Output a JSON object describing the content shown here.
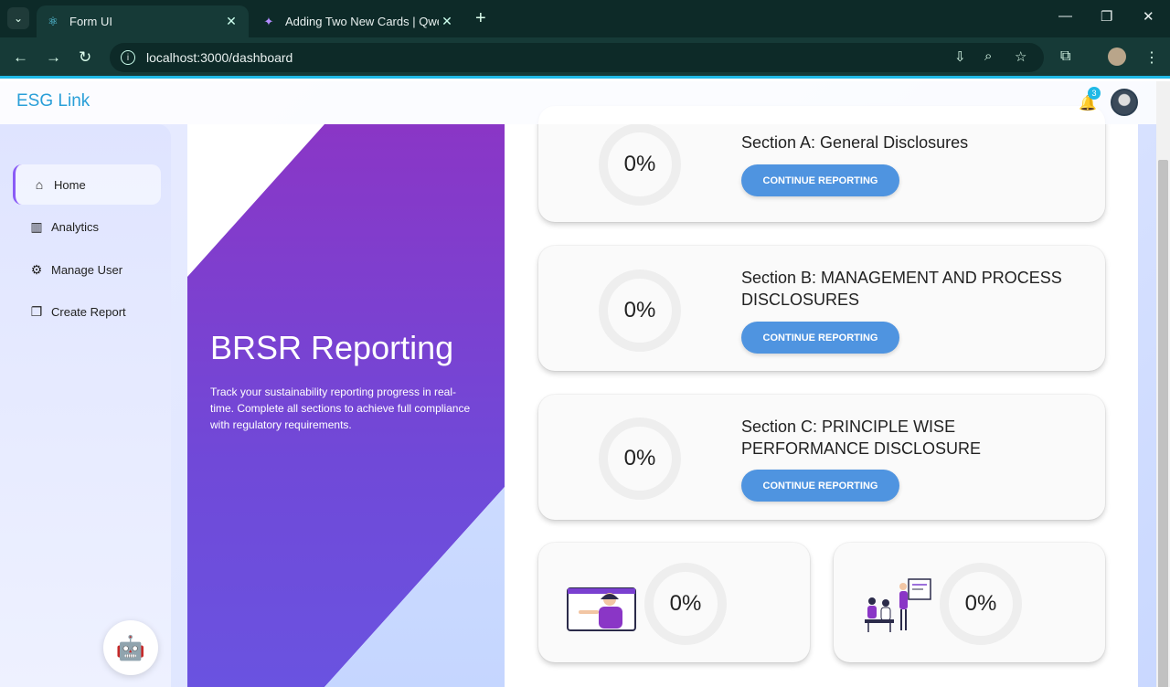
{
  "browser": {
    "tabs": [
      {
        "title": "Form UI",
        "icon": "react-icon",
        "active": true
      },
      {
        "title": "Adding Two New Cards | Qwen",
        "icon": "qwen-icon",
        "active": false
      }
    ],
    "url": "localhost:3000/dashboard"
  },
  "header": {
    "brand": "ESG Link",
    "notification_count": "3"
  },
  "sidebar": {
    "items": [
      {
        "label": "Home",
        "icon": "home-icon"
      },
      {
        "label": "Analytics",
        "icon": "analytics-icon"
      },
      {
        "label": "Manage User",
        "icon": "manage-user-icon"
      },
      {
        "label": "Create Report",
        "icon": "create-report-icon"
      }
    ]
  },
  "hero": {
    "title": "BRSR Reporting",
    "description": "Track your sustainability reporting progress in real-time. Complete all sections to achieve full compliance with regulatory requirements."
  },
  "sections": [
    {
      "title": "Section A: General Disclosures",
      "progress": "0%",
      "button": "CONTINUE REPORTING"
    },
    {
      "title": "Section B: MANAGEMENT AND PROCESS DISCLOSURES",
      "progress": "0%",
      "button": "CONTINUE REPORTING"
    },
    {
      "title": "Section C: PRINCIPLE WISE PERFORMANCE DISCLOSURE",
      "progress": "0%",
      "button": "CONTINUE REPORTING"
    }
  ],
  "small_cards": [
    {
      "progress": "0%",
      "illustration": "presenter-illustration"
    },
    {
      "progress": "0%",
      "illustration": "team-illustration"
    }
  ],
  "colors": {
    "brand": "#2a9fd8",
    "accent": "#8a5cf6",
    "button": "#4f94e0",
    "hero": "#7a40d0"
  }
}
